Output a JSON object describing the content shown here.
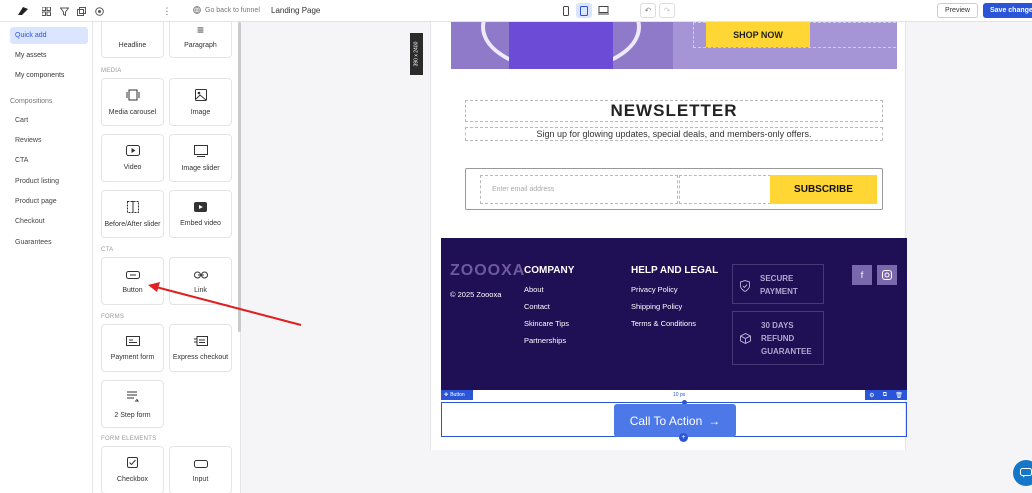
{
  "topbar": {
    "icons": [
      "logo-icon",
      "grid-icon",
      "filter-icon",
      "copy-icon",
      "settings-icon",
      "more-icon"
    ],
    "back_label": "Go back to funnel",
    "page_title": "Landing Page",
    "preview_label": "Preview",
    "save_label": "Save changes"
  },
  "left": {
    "tabs": [
      {
        "label": "Quick add"
      },
      {
        "label": "My assets"
      },
      {
        "label": "My components"
      }
    ],
    "group_label": "Compositions",
    "items": [
      {
        "label": "Cart"
      },
      {
        "label": "Reviews"
      },
      {
        "label": "CTA"
      },
      {
        "label": "Product listing"
      },
      {
        "label": "Product page"
      },
      {
        "label": "Checkout"
      },
      {
        "label": "Guarantees"
      }
    ]
  },
  "elements": {
    "headline": "Headline",
    "paragraph": "Paragraph",
    "media_section": "MEDIA",
    "media_carousel": "Media carousel",
    "image": "Image",
    "video": "Video",
    "image_slider": "Image slider",
    "before_after": "Before/After slider",
    "embed_video": "Embed video",
    "cta_section": "CTA",
    "button": "Button",
    "link": "Link",
    "forms_section": "FORMS",
    "payment_form": "Payment form",
    "express_checkout": "Express checkout",
    "two_step": "2 Step form",
    "form_elements_section": "FORM ELEMENTS",
    "checkbox": "Checkbox",
    "input": "Input"
  },
  "canvas": {
    "ruler": "390 x 2400",
    "shop_now": "SHOP NOW",
    "newsletter_title": "NEWSLETTER",
    "newsletter_sub": "Sign up for glowing updates, special deals, and members-only offers.",
    "email_placeholder": "Enter email address",
    "subscribe": "SUBSCRIBE",
    "footer": {
      "logo": "ZOOOXA",
      "copyright": "© 2025 Zoooxa",
      "company_head": "COMPANY",
      "company_links": [
        "About",
        "Contact",
        "Skincare Tips",
        "Partnerships"
      ],
      "help_head": "HELP AND LEGAL",
      "help_links": [
        "Privacy Policy",
        "Shipping Policy",
        "Terms & Conditions"
      ],
      "badge1_l1": "SECURE",
      "badge1_l2": "PAYMENT",
      "badge2_l1": "30 DAYS",
      "badge2_l2": "REFUND",
      "badge2_l3": "GUARANTEE",
      "social_fb": "f"
    },
    "selected_label": "Button",
    "spacing": "10 px",
    "cta_label": "Call To Action"
  },
  "colors": {
    "accent": "#2b55d8",
    "footer_bg": "#1f0f54",
    "yellow": "#ffd633",
    "annotation_arrow": "#e02020"
  }
}
